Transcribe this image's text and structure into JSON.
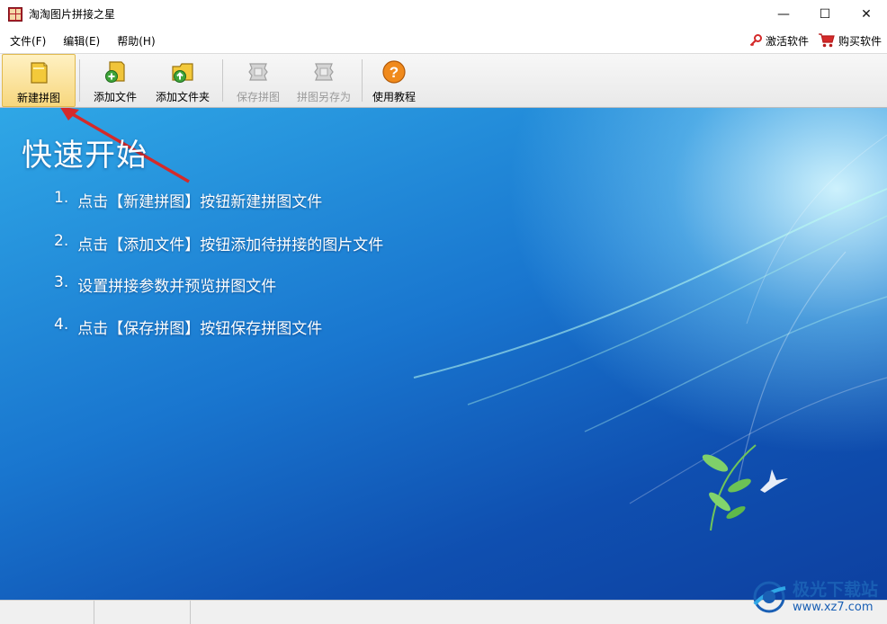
{
  "window": {
    "title": "淘淘图片拼接之星",
    "controls": [
      "—",
      "☐",
      "✕"
    ]
  },
  "menu": {
    "items": [
      "文件(F)",
      "编辑(E)",
      "帮助(H)"
    ],
    "right": [
      {
        "label": "激活软件",
        "icon": "key-icon"
      },
      {
        "label": "购买软件",
        "icon": "cart-icon"
      }
    ]
  },
  "toolbar": {
    "buttons": [
      {
        "label": "新建拼图",
        "icon": "new-collage-icon",
        "enabled": true
      },
      {
        "label": "添加文件",
        "icon": "add-file-icon",
        "enabled": true
      },
      {
        "label": "添加文件夹",
        "icon": "add-folder-icon",
        "enabled": true
      },
      {
        "label": "保存拼图",
        "icon": "save-collage-icon",
        "enabled": false
      },
      {
        "label": "拼图另存为",
        "icon": "save-as-icon",
        "enabled": false
      },
      {
        "label": "使用教程",
        "icon": "help-icon",
        "enabled": true
      }
    ]
  },
  "main": {
    "heading": "快速开始",
    "steps": [
      {
        "num": "1.",
        "text": "点击【新建拼图】按钮新建拼图文件"
      },
      {
        "num": "2.",
        "text": "点击【添加文件】按钮添加待拼接的图片文件"
      },
      {
        "num": "3.",
        "text": "设置拼接参数并预览拼图文件"
      },
      {
        "num": "4.",
        "text": "点击【保存拼图】按钮保存拼图文件"
      }
    ]
  },
  "watermark": {
    "name": "极光下载站",
    "url": "www.xz7.com"
  },
  "colors": {
    "accent_arrow": "#d42a2a",
    "brand_blue": "#1a5fb4"
  }
}
